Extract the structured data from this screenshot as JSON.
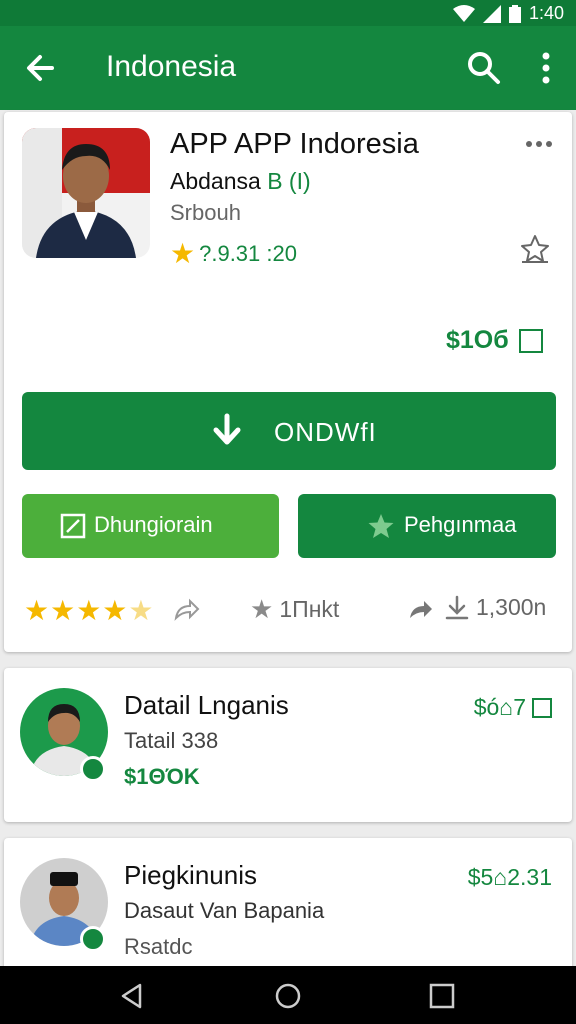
{
  "status_bar": {
    "time": "1:40"
  },
  "app_bar": {
    "title": "Indonesia"
  },
  "app": {
    "title": "APP APP Indoresia",
    "developer": "Abdansa",
    "developer_tag": "B (I)",
    "subtitle": "Srbouh",
    "rating_text": "?.9.31 :20",
    "price": "$1Oб",
    "install_label": "ONDWfI",
    "secondary_left_label": "Dhungiorain",
    "secondary_right_label": "Pehgınmaa",
    "stats": {
      "stars_filled": 4,
      "stars_total": 5,
      "count_label": "1Πнkt",
      "downloads": "1,300n"
    }
  },
  "items": [
    {
      "title": "Datail Lnganis",
      "subtitle": "Tatail  338",
      "price": "$1ΘΌK",
      "right_label": "$ó⌂7"
    },
    {
      "title": "Piegkinunis",
      "subtitle": "Dasaut Van Bapania",
      "price": "Rsatdc",
      "right_label": "$5⌂2.31"
    }
  ],
  "colors": {
    "primary": "#14873f",
    "primary_dark": "#0f7a37",
    "accent_light": "#4caf3b",
    "star": "#f5b800"
  },
  "icons": [
    "back-arrow-icon",
    "search-icon",
    "more-vert-icon",
    "more-horiz-icon",
    "wishlist-icon",
    "download-icon",
    "edit-icon",
    "star-icon",
    "share-icon",
    "verified-icon",
    "nav-back-icon",
    "nav-home-icon",
    "nav-recents-icon"
  ]
}
